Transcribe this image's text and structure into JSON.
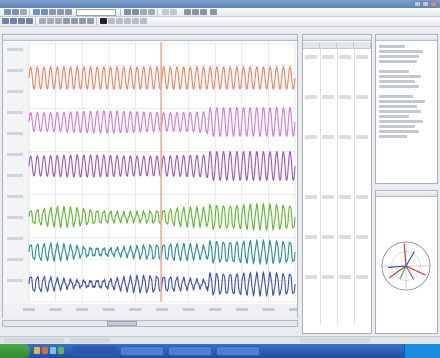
{
  "window": {
    "title": ""
  },
  "toolbar": {
    "combo_value": ""
  },
  "colors": {
    "wave_1": "#f07f5e",
    "wave_2": "#cd7ad8",
    "wave_3": "#9a56b8",
    "wave_4": "#61b530",
    "wave_5": "#2a8e8c",
    "wave_6": "#3a4eaf",
    "cursor": "#f3a98c",
    "grid": "#d8dce2",
    "phasor_red": "#d0322f",
    "phasor_blue": "#2f45b4",
    "phasor_purple": "#8c4fb8",
    "phasor_green": "#4aa637"
  },
  "icons": {
    "start": "windows-start-icon",
    "tray": "system-tray-icon"
  }
}
